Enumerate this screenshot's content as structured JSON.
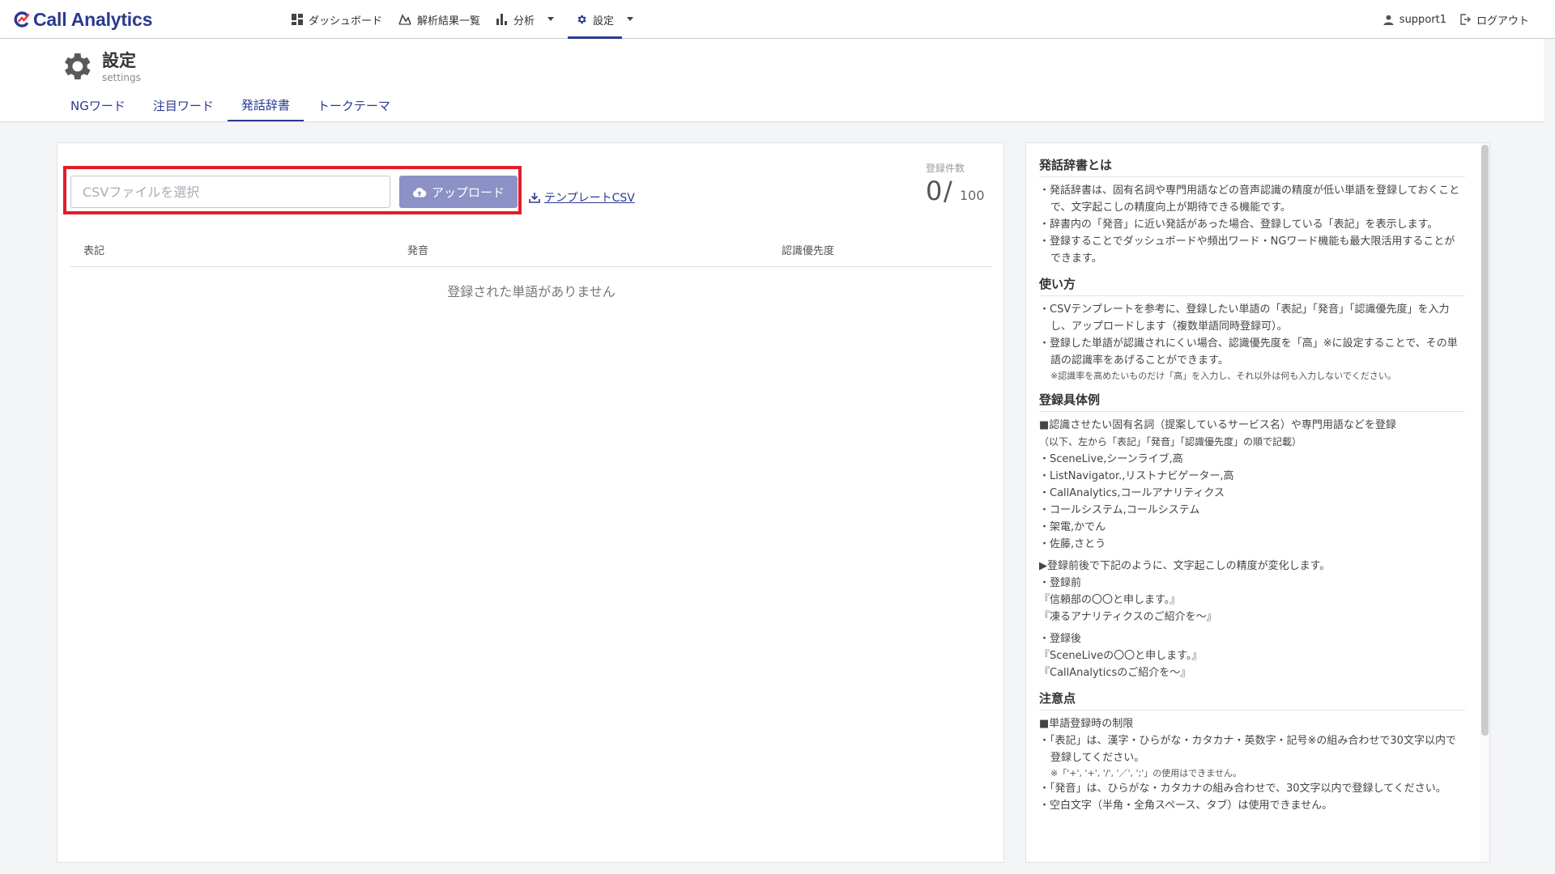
{
  "brand": {
    "name": "Call Analytics",
    "color": "#2b3a8f"
  },
  "nav": {
    "items": [
      {
        "label": "ダッシュボード",
        "icon": "dashboard-icon"
      },
      {
        "label": "解析結果一覧",
        "icon": "chart-line-icon"
      },
      {
        "label": "分析",
        "icon": "bar-chart-icon"
      },
      {
        "label": "設定",
        "icon": "gear-icon",
        "active": true
      }
    ],
    "user": "support1",
    "logout": "ログアウト"
  },
  "settings": {
    "title": "設定",
    "subtitle": "settings",
    "tabs": [
      "NGワード",
      "注目ワード",
      "発話辞書",
      "トークテーマ"
    ],
    "active_tab": "発話辞書"
  },
  "upload": {
    "placeholder": "CSVファイルを選択",
    "button": "アップロード",
    "template_link": "テンプレートCSV",
    "highlight_color": "#e01e2b"
  },
  "count": {
    "label": "登録件数",
    "current": "0",
    "slash": "/",
    "max": "100"
  },
  "table": {
    "headers": [
      "表記",
      "発音",
      "認識優先度"
    ],
    "empty_message": "登録された単語がありません"
  },
  "help": {
    "about_title": "発話辞書とは",
    "about": [
      "発話辞書は、固有名詞や専門用語などの音声認識の精度が低い単語を登録しておくことで、文字起こしの精度向上が期待できる機能です。",
      "辞書内の「発音」に近い発話があった場合、登録している「表記」を表示します。",
      "登録することでダッシュボードや頻出ワード・NGワード機能も最大限活用することができます。"
    ],
    "usage_title": "使い方",
    "usage": [
      "CSVテンプレートを参考に、登録したい単語の「表記」「発音」「認識優先度」を入力し、アップロードします（複数単語同時登録可）。",
      "登録した単語が認識されにくい場合、認識優先度を「高」※に設定することで、その単語の認識率をあげることができます。"
    ],
    "usage_note": "※認識率を高めたいものだけ「高」を入力し、それ以外は何も入力しないでください。",
    "examples_title": "登録具体例",
    "examples_intro": "■認識させたい固有名詞（提案しているサービス名）や専門用語などを登録",
    "examples_order": "（以下、左から「表記」「発音」「認識優先度」の順で記載）",
    "examples": [
      "SceneLive,シーンライブ,高",
      "ListNavigator.,リストナビゲーター,高",
      "CallAnalytics,コールアナリティクス",
      "コールシステム,コールシステム",
      "架電,かでん",
      "佐藤,さとう"
    ],
    "change_intro": "▶登録前後で下記のように、文字起こしの精度が変化します。",
    "before_label": "登録前",
    "before": [
      "『信頼部の〇〇と申します。』",
      "『凍るアナリティクスのご紹介を～』"
    ],
    "after_label": "登録後",
    "after": [
      "『SceneLiveの〇〇と申します。』",
      "『CallAnalyticsのご紹介を～』"
    ],
    "notes_title": "注意点",
    "notes_intro": "■単語登録時の制限",
    "note1": "「表記」は、漢字・ひらがな・カタカナ・英数字・記号※の組み合わせで30文字以内で登録してください。",
    "note1_sub": "※「'+', '+', '/', '／', ';'」の使用はできません。",
    "note2": "「発音」は、ひらがな・カタカナの組み合わせで、30文字以内で登録してください。",
    "note3": "空白文字（半角・全角スペース、タブ）は使用できません。"
  }
}
